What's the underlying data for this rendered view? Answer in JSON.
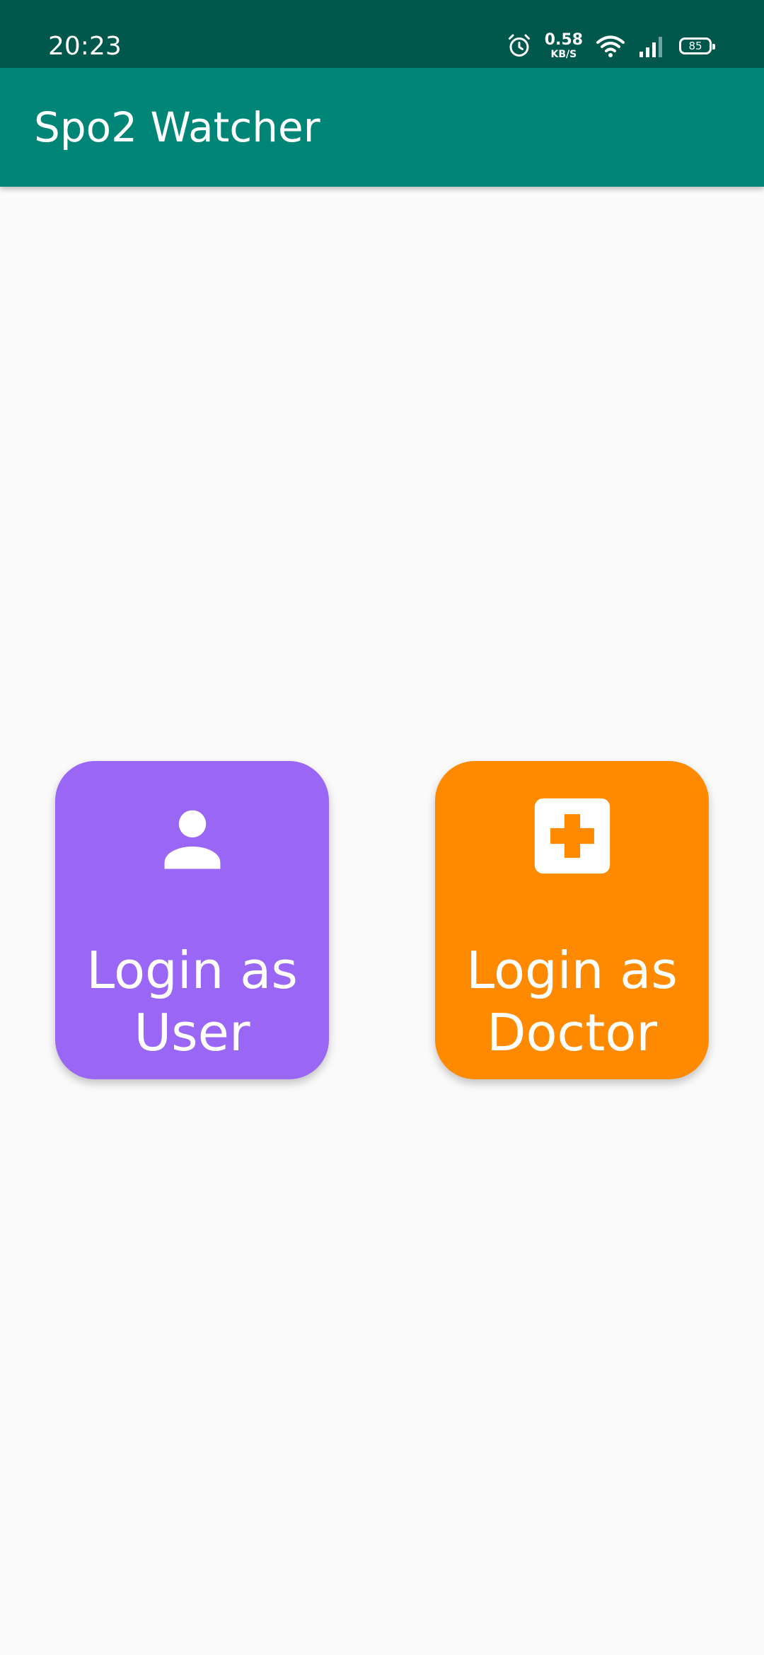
{
  "status_bar": {
    "time": "20:23",
    "net_speed_value": "0.58",
    "net_speed_unit": "KB/S",
    "battery_level": "85",
    "icons": [
      "alarm-icon",
      "wifi-icon",
      "signal-icon",
      "battery-icon"
    ]
  },
  "app_bar": {
    "title": "Spo2 Watcher"
  },
  "login_options": {
    "user": {
      "label_line1": "Login as",
      "label_line2": "User",
      "icon": "person-icon",
      "color": "#9966f5"
    },
    "doctor": {
      "label_line1": "Login as",
      "label_line2": "Doctor",
      "icon": "medical-cross-icon",
      "color": "#ff8a00"
    }
  },
  "colors": {
    "status_bar": "#00574b",
    "app_bar": "#008577",
    "background": "#fafafa"
  }
}
